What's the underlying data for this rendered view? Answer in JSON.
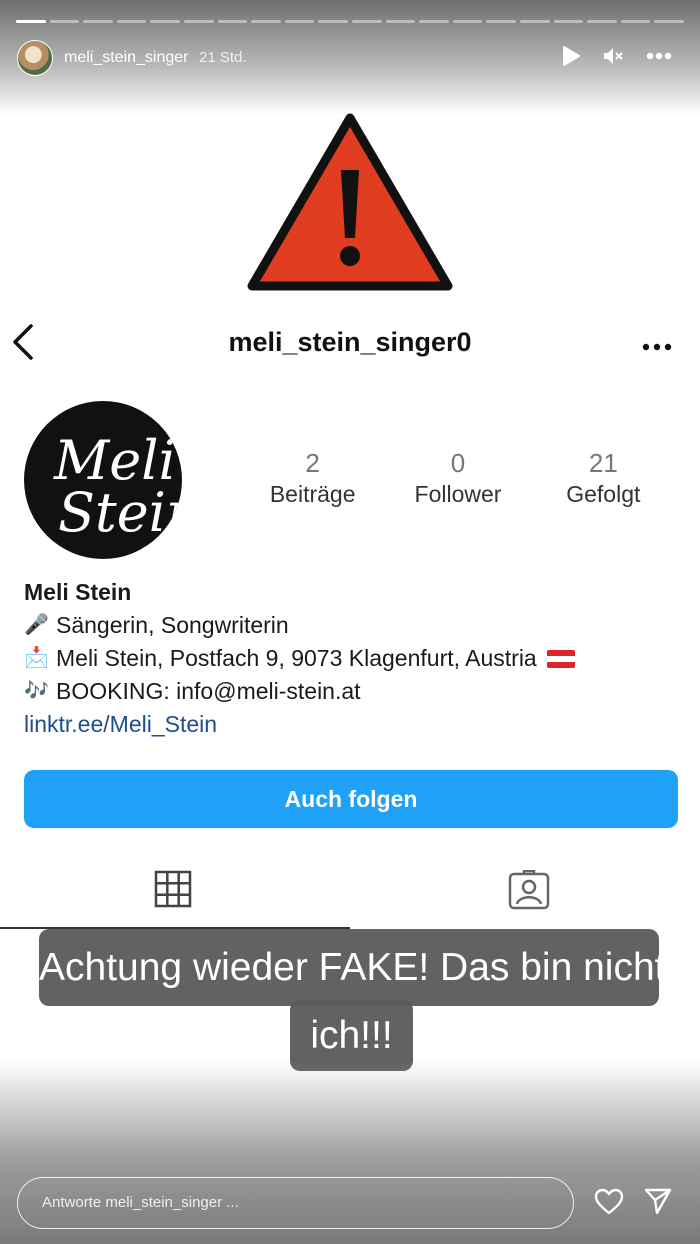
{
  "story": {
    "username": "meli_stein_singer",
    "time": "21 Std.",
    "segments_total": 20,
    "segments_done": 1,
    "icons": [
      "play-icon",
      "mute-icon",
      "more-icon"
    ]
  },
  "profile": {
    "handle": "meli_stein_singer0",
    "avatar_text_line1": "Meli",
    "avatar_text_line2": "Stein",
    "stats": [
      {
        "num": "2",
        "label": "Beiträge"
      },
      {
        "num": "0",
        "label": "Follower"
      },
      {
        "num": "21",
        "label": "Gefolgt"
      }
    ],
    "bio": {
      "name": "Meli Stein",
      "line1_icon": "🎤",
      "line1": "Sängerin, Songwriterin",
      "line2_icon": "📩",
      "line2": "Meli Stein, Postfach 9, 9073 Klagenfurt, Austria",
      "line3_icon": "🎶",
      "line3": "BOOKING: info@meli-stein.at",
      "link": "linktr.ee/Meli_Stein"
    },
    "follow_button": "Auch folgen"
  },
  "caption": {
    "line1": "Achtung wieder FAKE! Das bin nicht",
    "line2": "ich!!!"
  },
  "reply": {
    "placeholder": "Antworte meli_stein_singer ..."
  },
  "colors": {
    "follow_blue": "#1ea1f7",
    "warning_red": "#e03c1f",
    "link_blue": "#1f4e8b"
  }
}
